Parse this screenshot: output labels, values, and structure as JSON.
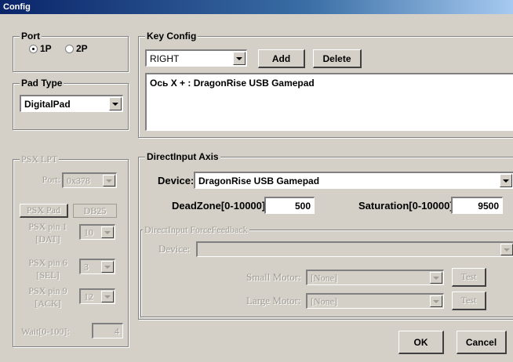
{
  "window": {
    "title": "Config"
  },
  "port": {
    "title": "Port",
    "options": [
      {
        "label": "1P",
        "selected": true
      },
      {
        "label": "2P",
        "selected": false
      }
    ]
  },
  "pad_type": {
    "title": "Pad Type",
    "selected": "DigitalPad"
  },
  "psx_lpt": {
    "title": "PSX LPT",
    "port_label": "Port:",
    "port_value": "0x378",
    "psx_pad_tab": "PSX Pad",
    "db25_tab": "DB25",
    "pins": [
      {
        "label": "PSX pin 1",
        "sub": "[DAT]",
        "value": "10"
      },
      {
        "label": "PSX pin 6",
        "sub": "[SEL]",
        "value": "3"
      },
      {
        "label": "PSX pin 9",
        "sub": "[ACK]",
        "value": "12"
      }
    ],
    "wait_label": "Wait[0-100]:",
    "wait_value": "4"
  },
  "key_config": {
    "title": "Key Config",
    "key_selected": "RIGHT",
    "add_label": "Add",
    "delete_label": "Delete",
    "mappings": [
      "Ось X + : DragonRise USB Gamepad"
    ]
  },
  "direct_input_axis": {
    "title": "DirectInput Axis",
    "device_label": "Device:",
    "device_value": "DragonRise USB Gamepad",
    "deadzone_label": "DeadZone[0-10000]:",
    "deadzone_value": "500",
    "saturation_label": "Saturation[0-10000]:",
    "saturation_value": "9500"
  },
  "force_feedback": {
    "title": "DirectInput ForceFeedback",
    "device_label": "Device:",
    "device_value": "",
    "small_motor_label": "Small Motor:",
    "small_motor_value": "[None]",
    "large_motor_label": "Large Motor:",
    "large_motor_value": "[None]",
    "test_label": "Test"
  },
  "footer": {
    "ok_label": "OK",
    "cancel_label": "Cancel"
  }
}
